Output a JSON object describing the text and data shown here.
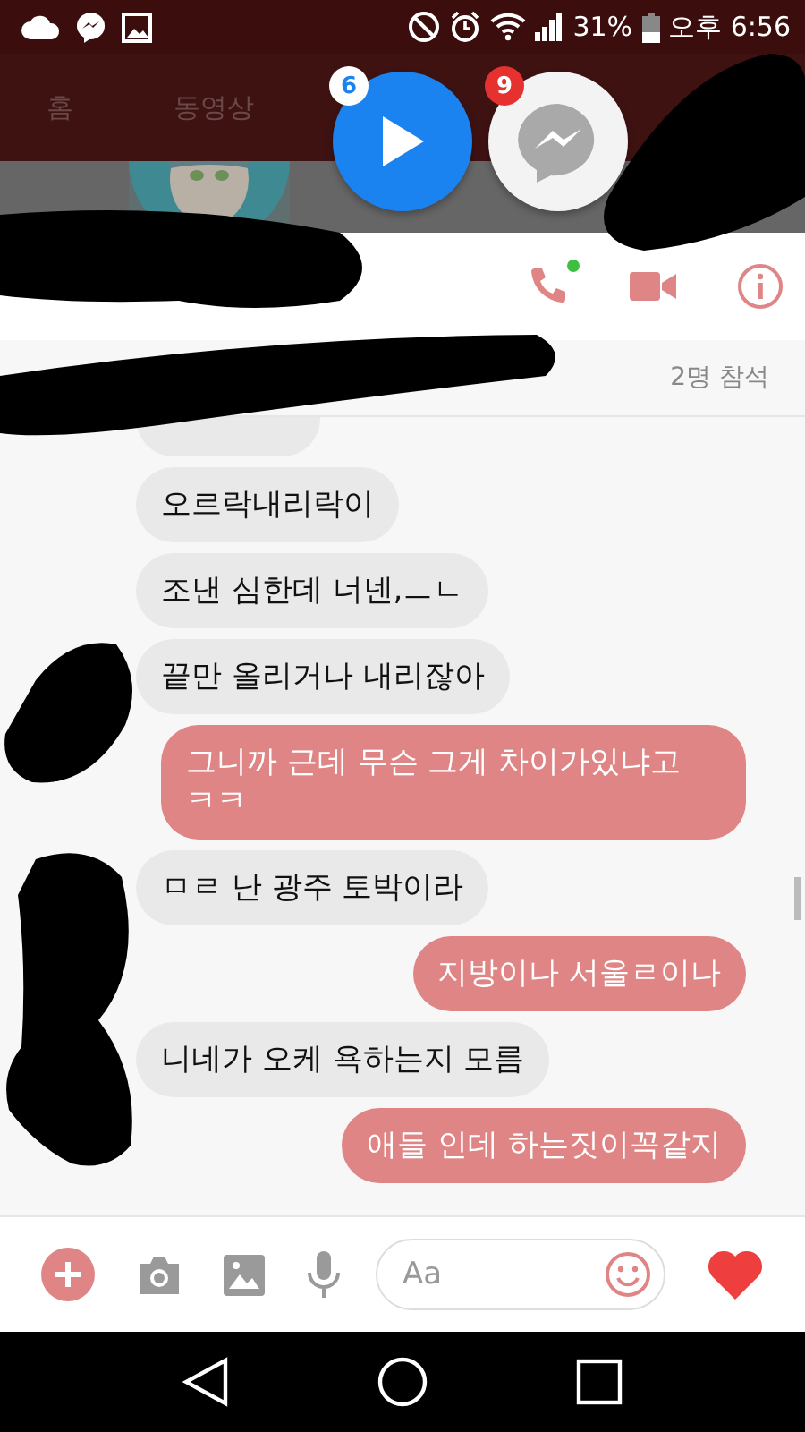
{
  "status_bar": {
    "battery": "31%",
    "time": "오후 6:56"
  },
  "tabs": [
    {
      "label": "홈"
    },
    {
      "label": "동영상"
    }
  ],
  "chat_heads": [
    {
      "kind": "video",
      "badge": "6"
    },
    {
      "kind": "messenger",
      "badge": "9"
    }
  ],
  "header": {
    "call_online": true
  },
  "participants": "2명 참석",
  "messages": [
    {
      "kind": "received",
      "text": "오르락내리락이"
    },
    {
      "kind": "received",
      "text": "조낸 심한데 너넨,ㅡㄴ"
    },
    {
      "kind": "received",
      "text": "끝만 올리거나 내리잖아"
    },
    {
      "kind": "sent",
      "text": "그니까 근데 무슨 그게 차이가있냐고 ㅋㅋ"
    },
    {
      "kind": "received",
      "text": "ㅁㄹ 난 광주 토박이라"
    },
    {
      "kind": "sent",
      "text": "지방이나 서울ㄹ이나"
    },
    {
      "kind": "received",
      "text": "니네가 오케 욕하는지 모름"
    },
    {
      "kind": "sent",
      "text": "애들 인데 하는짓이꼭같지"
    }
  ],
  "composer": {
    "placeholder": "Aa"
  }
}
